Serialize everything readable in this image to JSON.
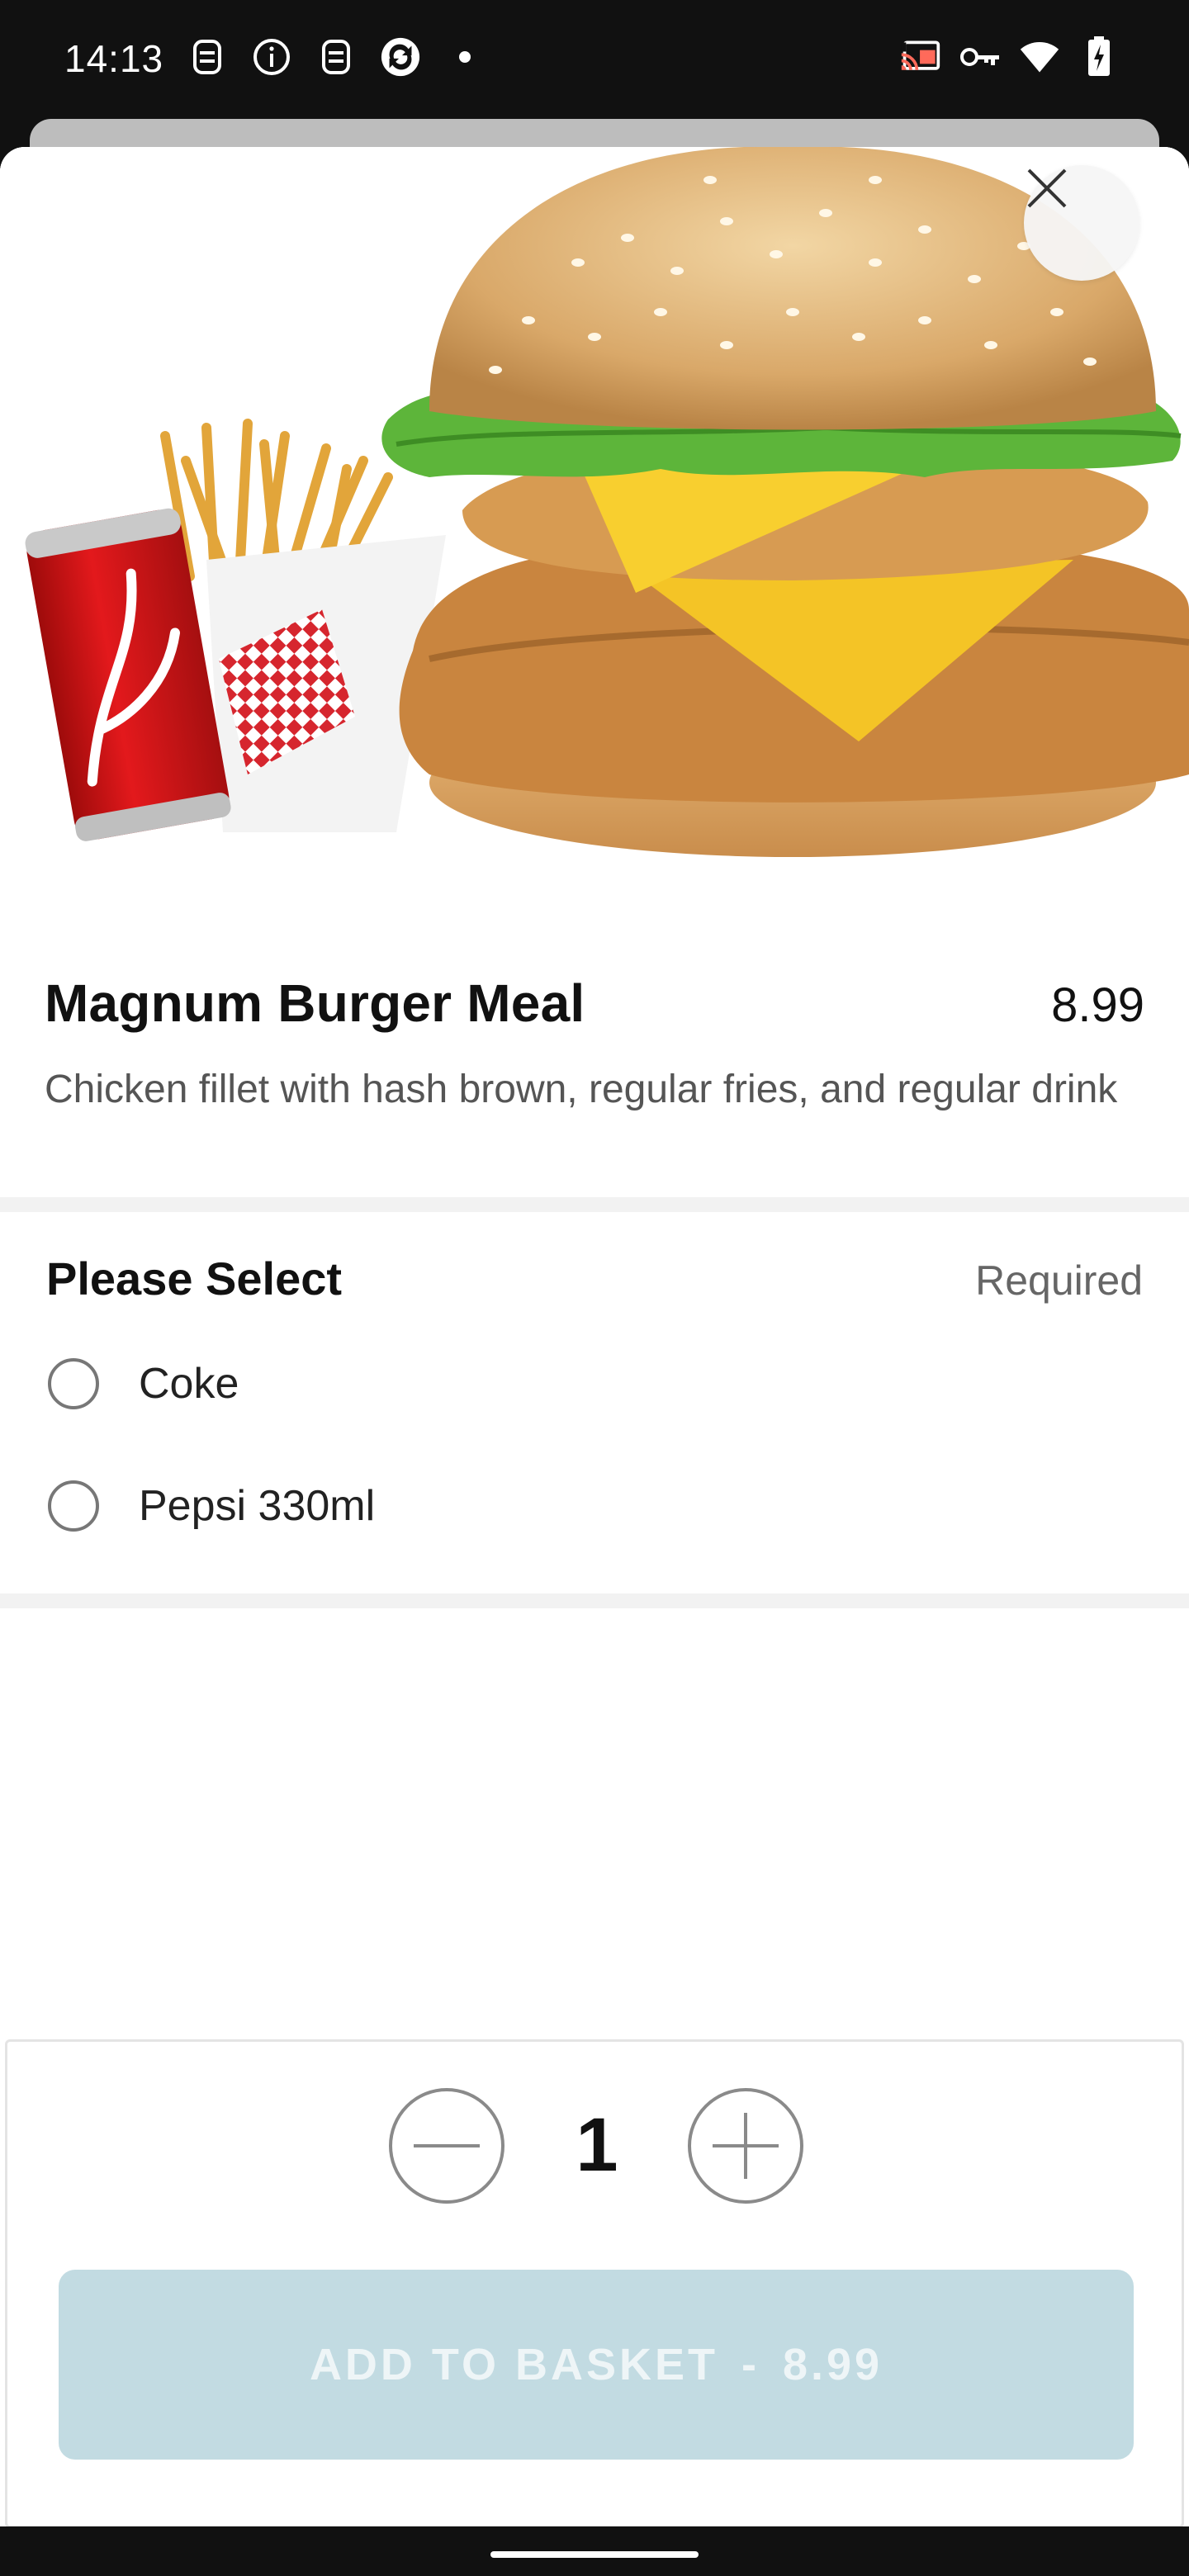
{
  "status_bar": {
    "time": "14:13",
    "left_icons": [
      "notification-icon",
      "info-icon",
      "notification-icon",
      "sync-app-icon",
      "dot-icon"
    ],
    "right_icons": [
      "cast-icon",
      "vpn-key-icon",
      "wifi-icon",
      "battery-charging-icon"
    ]
  },
  "item": {
    "name": "Magnum Burger Meal",
    "price": "8.99",
    "description": "Chicken fillet with hash brown, regular fries, and regular drink"
  },
  "section": {
    "title": "Please Select",
    "required_label": "Required",
    "options": [
      {
        "label": "Coke",
        "selected": false
      },
      {
        "label": "Pepsi 330ml",
        "selected": false
      }
    ]
  },
  "quantity": {
    "value": "1"
  },
  "add_button": {
    "label": "ADD TO BASKET",
    "separator": "-",
    "price": "8.99",
    "enabled": false
  },
  "colors": {
    "add_button_bg": "#c2dbe2",
    "add_button_text": "#eef5f7",
    "status_bar_bg": "#111111"
  }
}
